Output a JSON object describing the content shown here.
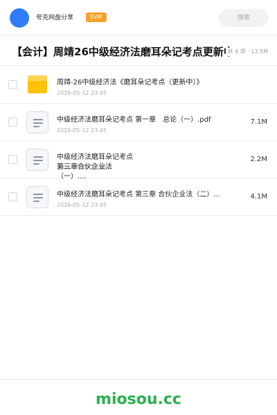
{
  "header": {
    "username": "夸克网盘分享",
    "badge": "SVIP",
    "search_placeholder": "搜索"
  },
  "share": {
    "title": "【会计】周靖26中级经济法磨耳朵记考点更新中",
    "meta": "共 4 项 · 13.5M"
  },
  "files": [
    {
      "name": "周靖-26中级经济法《磨耳朵记考点（更新中）》",
      "date": "2026-05-12 23:45",
      "size": "",
      "icon": "folder-icon"
    },
    {
      "name": "中级经济法磨耳朵记考点 第一章　总论（一）.pdf",
      "date": "2026-05-12 23:45",
      "size": "7.1M",
      "icon": "document-icon"
    },
    {
      "name": "中级经济法磨耳朵记考点 第三章合伙企业法（一）.…",
      "date": "2026-05-12 23:45",
      "size": "2.2M",
      "icon": "document-icon"
    },
    {
      "name": "中级经济法磨耳朵记考点 第三章 合伙企业法（二）…",
      "date": "2026-05-12 23:45",
      "size": "4.1M",
      "icon": "document-icon"
    }
  ],
  "footer": {
    "brand": "miosou.cc"
  },
  "colors": {
    "avatar": "#2f7cf6",
    "svip_badge": "#f7a12a",
    "folder": "#ffc107",
    "brand": "#27b24c"
  }
}
